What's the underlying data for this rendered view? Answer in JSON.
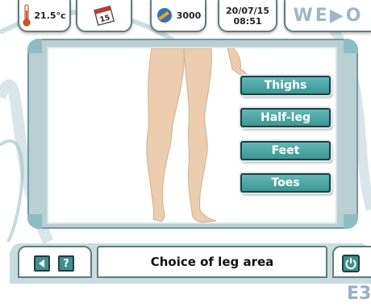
{
  "header": {
    "temperature": "21.5°c",
    "calendar_day": "15",
    "counter": "3000",
    "date": "20/07/15",
    "time": "08:51",
    "logo": "WE▶O"
  },
  "options": [
    {
      "label": "Thighs"
    },
    {
      "label": "Half-leg"
    },
    {
      "label": "Feet"
    },
    {
      "label": "Toes"
    }
  ],
  "footer": {
    "title": "Choice of leg area",
    "help_label": "?",
    "page_code": "E3"
  },
  "colors": {
    "accent": "#3f9a98",
    "frame": "#b9cfd2",
    "skin": "#eccdaf"
  }
}
